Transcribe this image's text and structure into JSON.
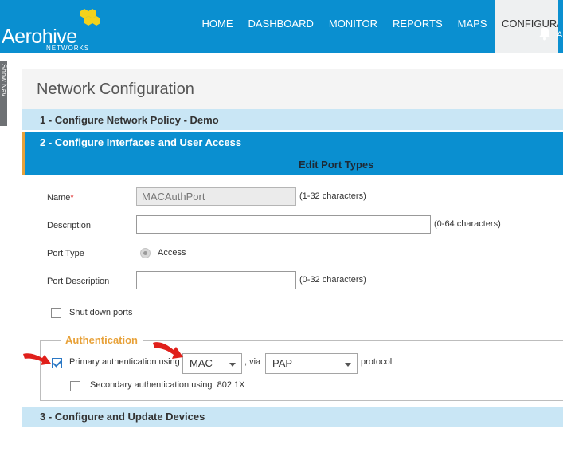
{
  "header": {
    "logo_text": "Aerohive",
    "logo_sub": "NETWORKS",
    "nav": [
      "HOME",
      "DASHBOARD",
      "MONITOR",
      "REPORTS",
      "MAPS",
      "CONFIGURA"
    ],
    "active_nav": "CONFIGURA",
    "user_initial": "A"
  },
  "sidetab": {
    "label": "Show Nav"
  },
  "page": {
    "title": "Network Configuration"
  },
  "steps": {
    "step1": "1 - Configure Network Policy - Demo",
    "step2": "2 - Configure Interfaces and User Access",
    "step2_sub": "Edit Port Types",
    "step3": "3 - Configure and Update Devices"
  },
  "form": {
    "name_label": "Name",
    "name_required": "*",
    "name_value": "MACAuthPort",
    "name_hint": "(1-32 characters)",
    "desc_label": "Description",
    "desc_value": "",
    "desc_hint": "(0-64 characters)",
    "port_type_label": "Port Type",
    "port_type_value": "Access",
    "port_desc_label": "Port Description",
    "port_desc_value": "",
    "port_desc_hint": "(0-32 characters)",
    "shutdown_label": "Shut down ports",
    "shutdown_checked": false
  },
  "auth": {
    "legend": "Authentication",
    "primary_label": "Primary authentication using",
    "primary_checked": true,
    "primary_method": "MAC",
    "via_text": ", via",
    "protocol_value": "PAP",
    "protocol_text": "protocol",
    "secondary_label": "Secondary authentication using",
    "secondary_method": "802.1X",
    "secondary_checked": false
  },
  "colors": {
    "header_blue": "#0a8fd0",
    "step_light": "#c9e6f5",
    "accent_orange": "#e8a23a",
    "arrow_red": "#e0201b"
  }
}
